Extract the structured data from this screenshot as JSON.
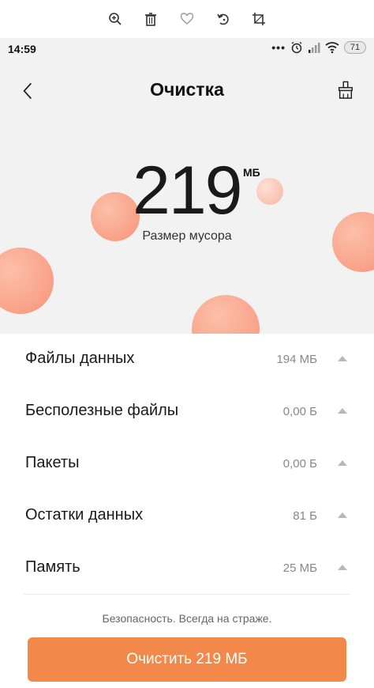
{
  "viewer_toolbar": {
    "icons": [
      "zoom-in-icon",
      "trash-icon",
      "heart-icon",
      "rotate-icon",
      "crop-icon"
    ]
  },
  "status_bar": {
    "time": "14:59",
    "dots": "•••",
    "battery": "71"
  },
  "header": {
    "title": "Очистка"
  },
  "hero": {
    "size_value": "219",
    "size_unit": "МБ",
    "subtitle": "Размер мусора",
    "bubble_color": "#f8937a"
  },
  "items": [
    {
      "label": "Файлы данных",
      "value": "194 МБ"
    },
    {
      "label": "Бесполезные файлы",
      "value": "0,00 Б"
    },
    {
      "label": "Пакеты",
      "value": "0,00 Б"
    },
    {
      "label": "Остатки данных",
      "value": "81 Б"
    },
    {
      "label": "Память",
      "value": "25 МБ"
    }
  ],
  "footer": {
    "tagline": "Безопасность. Всегда на страже.",
    "button_label": "Очистить 219 МБ",
    "accent_color": "#f2894a"
  }
}
